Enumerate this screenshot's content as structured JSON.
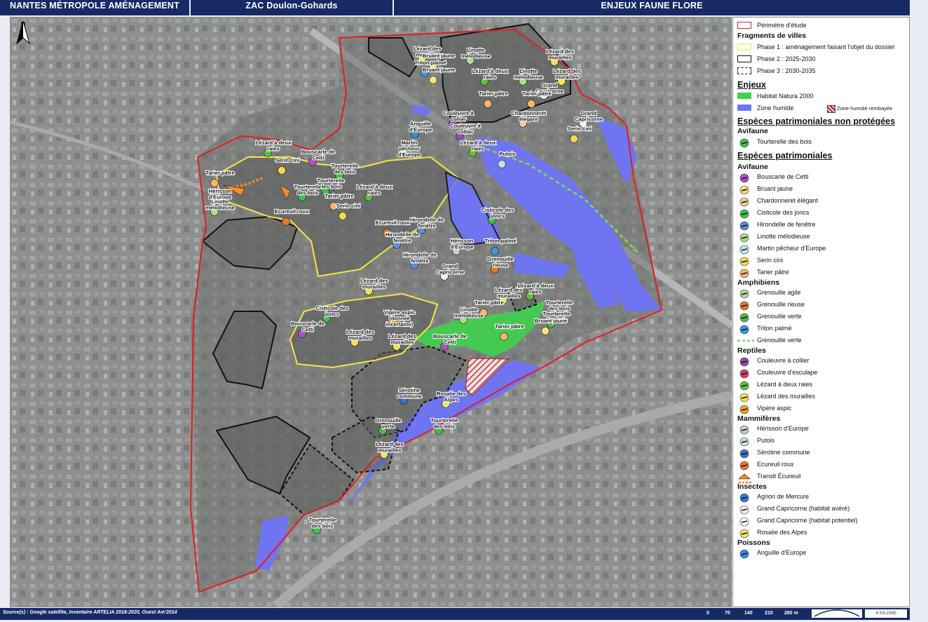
{
  "header": {
    "left": "NANTES MÉTROPOLE AMÉNAGEMENT",
    "center": "ZAC Doulon-Gohards",
    "right": "ENJEUX FAUNE FLORE"
  },
  "north": "N",
  "map_labels": [
    "Lézard des murailles",
    "Linotte mélodieuse",
    "Bruant jaune",
    "Triton palmé",
    "Bruant jaune",
    "Lézard des murailles",
    "Lézard des murailles",
    "Lézard à deux raies",
    "Linotte mélodieuse",
    "Grand Capricorne",
    "Grand Capricorne",
    "Tarier pâtre",
    "Tarier pâtre",
    "Chardonneret élégant",
    "Serin cini",
    "Couleuvre à collier",
    "Anguille d'Europe",
    "Couleuvre à collier",
    "Martin pêcheur d'Europe",
    "Lézard à deux raies",
    "Putois",
    "Lézard à deux raies",
    "Bouscarle de Cetti",
    "Serin cini",
    "Tourterelle des bois",
    "Tarier pâtre",
    "Tourterelle des bois",
    "Hérisson d'Europe",
    "Tourterelle des bois",
    "Linotte mélodieuse",
    "Ecureuil roux",
    "Tarier pâtre",
    "Lézard à deux raies",
    "Serin cini",
    "Cisticole des joncs",
    "Ecureuil roux",
    "Hirondelle de fenêtre",
    "Hirondelle de fenêtre",
    "Hérisson d'Europe",
    "Triton palmé",
    "Hirondelle de fenêtre",
    "Grenouille rieuse",
    "Grand Capricorne",
    "Lézard des murailles",
    "Lézard des murailles",
    "Lézard à deux raies",
    "Tourterelle des bois",
    "Tarier pâtre",
    "Linotte mélodieuse",
    "Tourterelle des bois",
    "Bruant jaune",
    "Tarier pâtre",
    "Cisticole des joncs",
    "Vipère aspic (donnée incertaine)",
    "Bouscarle de Cetti",
    "Lézard des murailles",
    "Lézard des murailles",
    "Bouscarle de Cetti",
    "Sérotine commune",
    "Rosalie des Alpes",
    "Grenouille verte",
    "Tourterelle des bois",
    "Lézard des murailles",
    "Tourterelle des bois"
  ],
  "legend": {
    "perimetre": "Périmètre d'étude",
    "fragments_title": "Fragments de villes",
    "phase1": "Phase 1 : aménagement faisant l'objet du dossier",
    "phase2": "Phase 2  : 2025-2030",
    "phase3": "Phase 3 : 2030-2035",
    "enjeux_title": "Enjeux",
    "natura": "Habitat Natura 2000",
    "zone_humide": "Zone humide",
    "zone_humide_remb": "Zone humide rembayée",
    "non_protegees_title": "Espèces patrimoniales non protégées",
    "avifaune1": "Avifaune",
    "tourterelle": "Tourterelle des bois",
    "patrimoniales_title": "Espèces patrimoniales",
    "groups": [
      {
        "name": "Avifaune",
        "items": [
          {
            "label": "Bouscarle de Cetti",
            "color": "#b14fc5"
          },
          {
            "label": "Bruant jaune",
            "color": "#f3e27a"
          },
          {
            "label": "Chardonneret élégant",
            "color": "#f0c7a0"
          },
          {
            "label": "Cisticole des joncs",
            "color": "#39c24a"
          },
          {
            "label": "Hirondelle de fenêtre",
            "color": "#5b8fd8"
          },
          {
            "label": "Linotte mélodieuse",
            "color": "#a8e089"
          },
          {
            "label": "Martin pêcheur d'Europe",
            "color": "#bfe6ef"
          },
          {
            "label": "Serin cini",
            "color": "#f7d84a"
          },
          {
            "label": "Tarier pâtre",
            "color": "#f5b56a"
          }
        ]
      },
      {
        "name": "Amphibiens",
        "items": [
          {
            "label": "Grenouille agile",
            "color": "#b5d69c"
          },
          {
            "label": "Grenouille rieuse",
            "color": "#e07a28"
          },
          {
            "label": "Grenouille verte",
            "color": "#54b84e"
          },
          {
            "label": "Triton palmé",
            "color": "#3a9be0"
          },
          {
            "label": "Grenouille verte",
            "color": "#7ddc4a"
          }
        ]
      },
      {
        "name": "Reptiles",
        "items": [
          {
            "label": "Couleuvre à collier",
            "color": "#8e4fb0"
          },
          {
            "label": "Couleuvre d'esculape",
            "color": "#d63d6a"
          },
          {
            "label": "Lézard à deux raies",
            "color": "#5fbf3c"
          },
          {
            "label": "Lézard des murailles",
            "color": "#f2e25c"
          },
          {
            "label": "Vipère aspic",
            "color": "#f0a020"
          }
        ]
      },
      {
        "name": "Mammifères",
        "items": [
          {
            "label": "Hérisson d'Europe",
            "color": "#c9d0c2"
          },
          {
            "label": "Putois",
            "color": "#c7ddea"
          },
          {
            "label": "Sérotine commune",
            "color": "#3c72c8"
          },
          {
            "label": "Ecureuil roux",
            "color": "#e8782a"
          },
          {
            "label": "Transit Écureuil",
            "color": "#f28c28"
          }
        ]
      },
      {
        "name": "Insectes",
        "items": [
          {
            "label": "Agrion de Mercure",
            "color": "#2f7fd8"
          },
          {
            "label": "Grand Capricorne (habitat avéré)",
            "color": "#f2f2f2"
          },
          {
            "label": "Grand Capricorne (habitat potentiel)",
            "color": "#ffffff"
          },
          {
            "label": "Rosalie des Alpes",
            "color": "#f4e26a"
          }
        ]
      },
      {
        "name": "Poissons",
        "items": [
          {
            "label": "Anguille d'Europe",
            "color": "#2f8fe0"
          }
        ]
      }
    ]
  },
  "colors": {
    "perimetre": "#e01e1e",
    "phase1": "#f5e642",
    "phase2": "#111111",
    "natura": "#3fd34c",
    "zone_humide": "#6f74f0",
    "header_bg": "#172a66"
  },
  "footer": {
    "source": "Source(s) : Google satellite, Inventaire ARTELIA 2018-2020, Ouest Am'2014",
    "scale": [
      "0",
      "70",
      "140",
      "210",
      "280 m"
    ],
    "ref": "4-53-2345"
  }
}
